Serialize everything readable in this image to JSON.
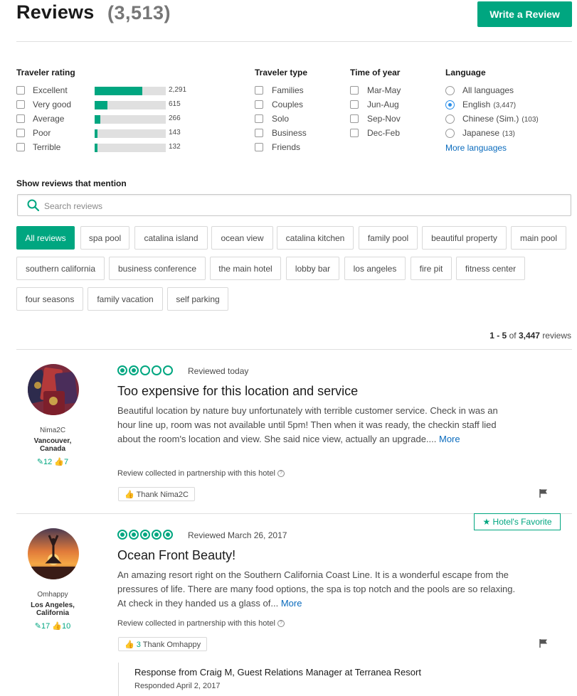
{
  "header": {
    "title": "Reviews",
    "count": "(3,513)",
    "write_review": "Write a Review"
  },
  "filters": {
    "traveler_rating": {
      "heading": "Traveler rating",
      "items": [
        {
          "label": "Excellent",
          "count": "2,291",
          "fraction": 0.67
        },
        {
          "label": "Very good",
          "count": "615",
          "fraction": 0.18
        },
        {
          "label": "Average",
          "count": "266",
          "fraction": 0.08
        },
        {
          "label": "Poor",
          "count": "143",
          "fraction": 0.04
        },
        {
          "label": "Terrible",
          "count": "132",
          "fraction": 0.04
        }
      ]
    },
    "traveler_type": {
      "heading": "Traveler type",
      "items": [
        "Families",
        "Couples",
        "Solo",
        "Business",
        "Friends"
      ]
    },
    "time_of_year": {
      "heading": "Time of year",
      "items": [
        "Mar-May",
        "Jun-Aug",
        "Sep-Nov",
        "Dec-Feb"
      ]
    },
    "language": {
      "heading": "Language",
      "items": [
        {
          "label": "All languages",
          "count": ""
        },
        {
          "label": "English",
          "count": "(3,447)"
        },
        {
          "label": "Chinese (Sim.)",
          "count": "(103)"
        },
        {
          "label": "Japanese",
          "count": "(13)"
        }
      ],
      "selected_label": "English",
      "more": "More languages"
    }
  },
  "mentions": {
    "heading": "Show reviews that mention",
    "placeholder": "Search reviews",
    "tags": [
      "All reviews",
      "spa pool",
      "catalina island",
      "ocean view",
      "catalina kitchen",
      "family pool",
      "beautiful property",
      "main pool",
      "southern california",
      "business conference",
      "the main hotel",
      "lobby bar",
      "los angeles",
      "fire pit",
      "fitness center",
      "four seasons",
      "family vacation",
      "self parking"
    ],
    "active": "All reviews"
  },
  "paging": {
    "range": "1 - 5",
    "of": "of",
    "total": "3,447",
    "suffix": "reviews"
  },
  "reviews": [
    {
      "user": "Nima2C",
      "location_line1": "Vancouver,",
      "location_line2": "Canada",
      "contributions": "12",
      "helpful_votes": "7",
      "rating": 2,
      "date": "Reviewed today",
      "title": "Too expensive for this location and service",
      "body": "Beautiful location by nature buy unfortunately with terrible customer service. Check in was an hour line up, room was not available until 5pm! Then when it was ready, the checkin staff lied about the room's location and view. She said nice view, actually an upgrade....",
      "more": "More",
      "collected": "Review collected in partnership with this hotel",
      "thank": "Thank Nima2C",
      "thank_count": ""
    },
    {
      "user": "Omhappy",
      "location_line1": "Los Angeles,",
      "location_line2": "California",
      "contributions": "17",
      "helpful_votes": "10",
      "rating": 5,
      "badge": "Hotel's Favorite",
      "date": "Reviewed March 26, 2017",
      "title": "Ocean Front Beauty!",
      "body": "An amazing resort right on the Southern California Coast Line. It is a wonderful escape from the pressures of life. There are many food options, the spa is top notch and the pools are so relaxing. At check in they handed us a glass of...",
      "more": "More",
      "collected": "Review collected in partnership with this hotel",
      "thank": "Thank Omhappy",
      "thank_count": "3",
      "response_title": "Response from Craig M, Guest Relations Manager at Terranea Resort",
      "response_date": "Responded April 2, 2017"
    }
  ],
  "colors": {
    "accent": "#00a680",
    "link": "#0a6bbd",
    "radio_selected": "#2a8ee8"
  }
}
